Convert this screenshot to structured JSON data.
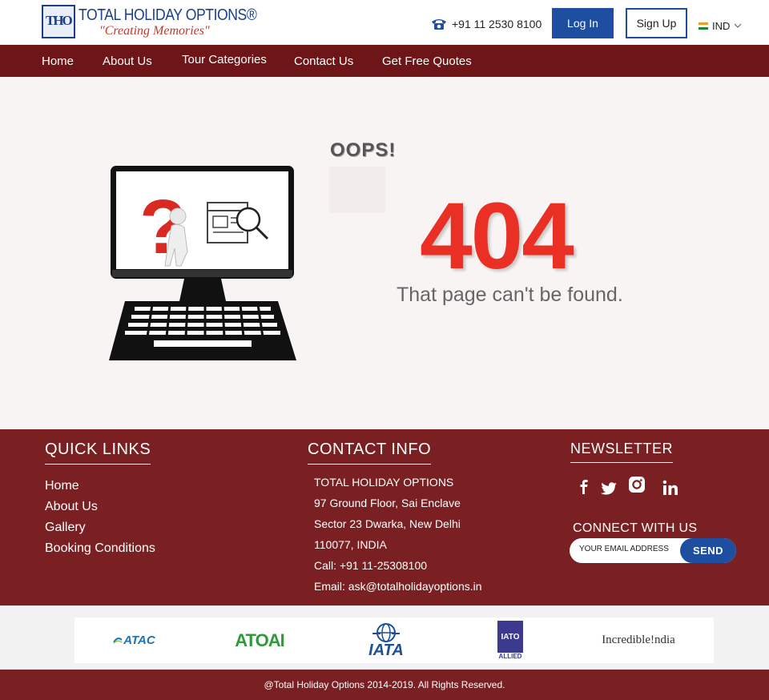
{
  "header": {
    "logo": {
      "mark": "THO",
      "title": "TOTAL HOLIDAY OPTIONS®",
      "tagline": "\"Creating Memories\""
    },
    "phone": "+91 11 2530 8100",
    "login_label": "Log In",
    "signup_label": "Sign Up",
    "country": "IND"
  },
  "nav": {
    "items": [
      "Home",
      "About Us",
      "Tour Categories",
      "Contact Us",
      "Get Free Quotes"
    ]
  },
  "error": {
    "oops": "OOPS!",
    "code": "404",
    "message": "That page can't be found."
  },
  "footer": {
    "quick_links": {
      "title": "QUICK LINKS",
      "items": [
        "Home",
        "About Us",
        "Gallery",
        "Booking Conditions"
      ]
    },
    "contact_info": {
      "title": "CONTACT INFO",
      "lines": [
        "TOTAL HOLIDAY OPTIONS",
        "97 Ground Floor, Sai Enclave",
        "Sector 23 Dwarka, New Delhi",
        "110077, INDIA",
        "Call: +91 11-25308100",
        "Email: ask@totalholidayoptions.in"
      ]
    },
    "newsletter": {
      "title": "NEWSLETTER",
      "social": [
        "facebook-icon",
        "twitter-icon",
        "instagram-icon",
        "linkedin-icon"
      ],
      "connect": "CONNECT WITH US",
      "email_placeholder": "YOUR EMAIL ADDRESS",
      "send_label": "SEND"
    }
  },
  "partners": {
    "atac": "ATAC",
    "atoai": "ATOAI",
    "iata": "IATA",
    "iato": "IATO",
    "iato_sub": "ALLIED",
    "incredible_india": "Incredible!ndia"
  },
  "copyright": "@Total Holiday Options 2014-2019. All Rights Reserved.",
  "colors": {
    "nav_bg": "#6e1518",
    "footer_bg": "#7a2022",
    "primary_blue": "#1d4ea0",
    "error_red": "#ea2f24"
  }
}
